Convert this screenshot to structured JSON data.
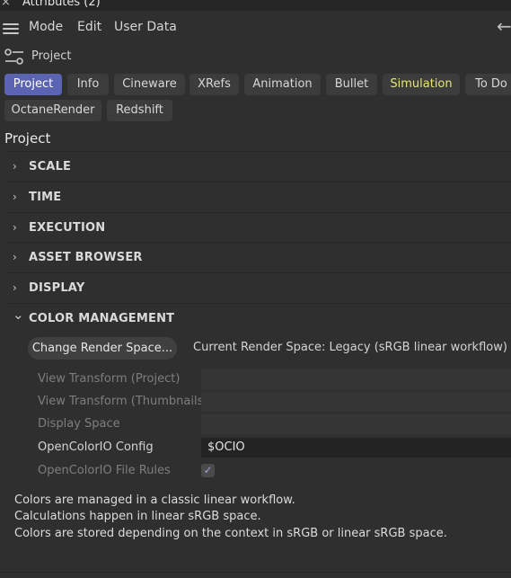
{
  "window": {
    "close_glyph": "×",
    "title": "Attributes (2)"
  },
  "menu": {
    "items": [
      "Mode",
      "Edit",
      "User Data"
    ],
    "back_glyph": "←"
  },
  "breadcrumb": {
    "label": "Project"
  },
  "tabs": [
    {
      "label": "Project",
      "active": true
    },
    {
      "label": "Info"
    },
    {
      "label": "Cineware"
    },
    {
      "label": "XRefs"
    },
    {
      "label": "Animation"
    },
    {
      "label": "Bullet"
    },
    {
      "label": "Simulation"
    },
    {
      "label": "To Do"
    },
    {
      "label": "OctaneRender"
    },
    {
      "label": "Redshift"
    }
  ],
  "section_title": "Project",
  "groups": [
    {
      "label": "SCALE",
      "expanded": false
    },
    {
      "label": "TIME",
      "expanded": false
    },
    {
      "label": "EXECUTION",
      "expanded": false
    },
    {
      "label": "ASSET BROWSER",
      "expanded": false
    },
    {
      "label": "DISPLAY",
      "expanded": false
    },
    {
      "label": "COLOR MANAGEMENT",
      "expanded": true
    }
  ],
  "chevrons": {
    "collapsed": "›",
    "expanded": "⌄"
  },
  "color_management": {
    "change_button": "Change Render Space...",
    "current_space": "Current Render Space: Legacy (sRGB linear workflow)",
    "fields": [
      {
        "label": "View Transform (Project)",
        "value": "",
        "enabled": false
      },
      {
        "label": "View Transform (Thumbnails)",
        "value": "",
        "enabled": false
      },
      {
        "label": "Display Space",
        "value": "",
        "enabled": false
      },
      {
        "label": "OpenColorIO Config",
        "value": "$OCIO",
        "enabled": true
      }
    ],
    "file_rules": {
      "label": "OpenColorIO File Rules",
      "checked": true,
      "enabled": false
    },
    "notes": [
      "Colors are managed in a classic linear workflow.",
      "Calculations happen in linear sRGB space.",
      "Colors are stored depending on the context in sRGB or linear sRGB space."
    ]
  },
  "colors": {
    "background": "#2f2f2f",
    "tab": "#3c3c3c",
    "tab_active": "#5b64b2",
    "simulation_text": "#e6e37e",
    "dim_text": "#7e7e7e"
  }
}
